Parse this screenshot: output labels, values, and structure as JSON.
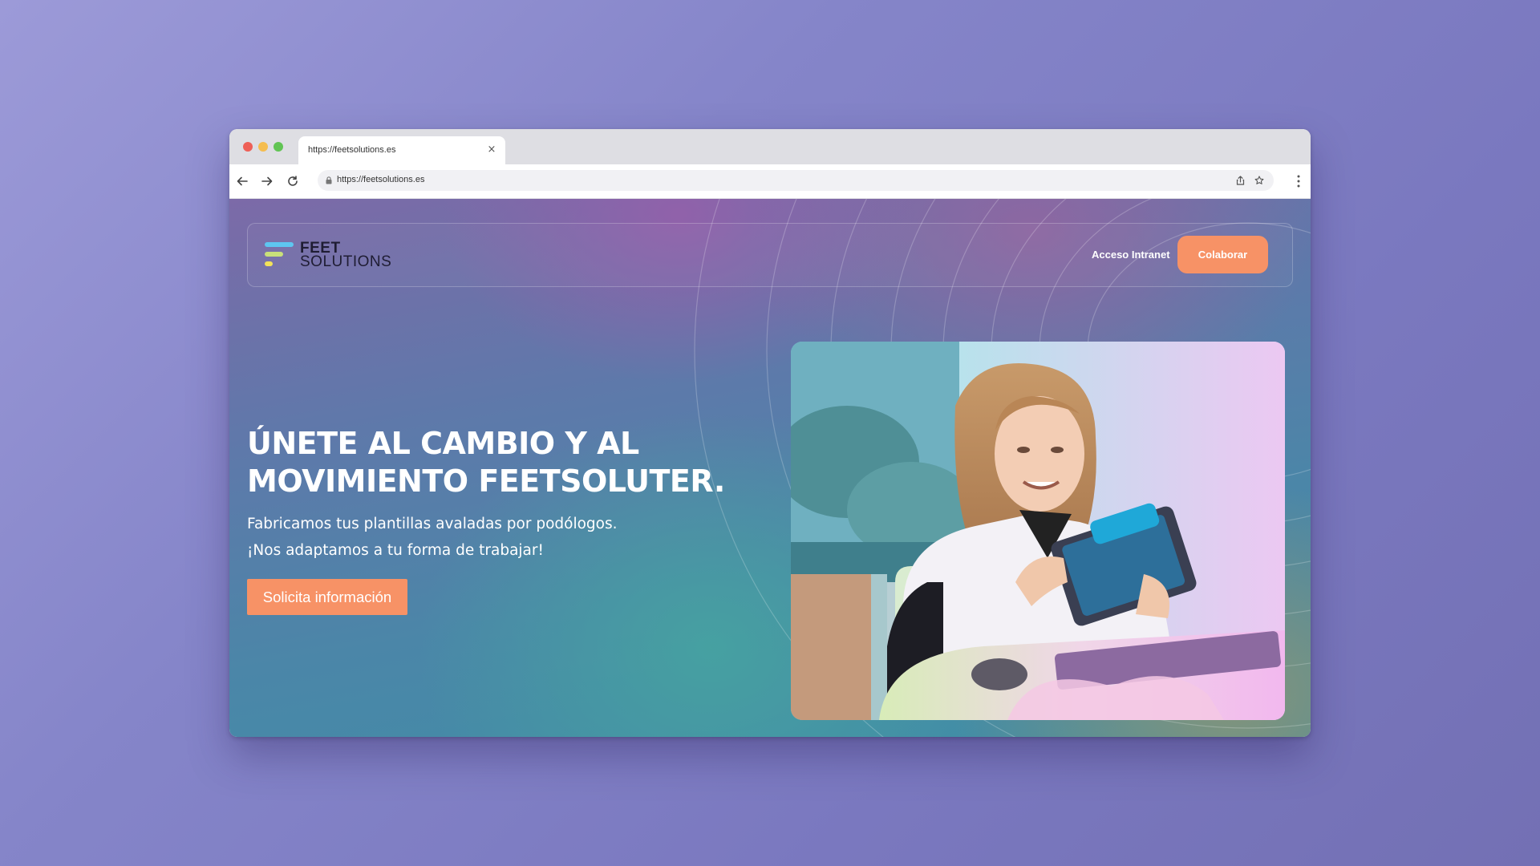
{
  "browser": {
    "tab_title": "https://feetsolutions.es",
    "tab_close": "×",
    "url": "https://feetsolutions.es"
  },
  "header": {
    "logo_line1": "FEET",
    "logo_line2": "SOLUTIONS",
    "intranet_link": "Acceso Intranet",
    "cta_label": "Colaborar"
  },
  "hero": {
    "title_line1": "ÚNETE AL CAMBIO Y AL",
    "title_line2": "MOVIMIENTO FEETSOLUTER.",
    "subtitle_line1": "Fabricamos tus plantillas avaladas por podólogos.",
    "subtitle_line2": "¡Nos adaptamos a tu forma de trabajar!",
    "cta_label": "Solicita información"
  },
  "colors": {
    "accent_orange": "#f79266",
    "logo_bar_1": "#5ec6f0",
    "logo_bar_2": "#c9e07a",
    "logo_bar_3": "#f2e25a"
  }
}
